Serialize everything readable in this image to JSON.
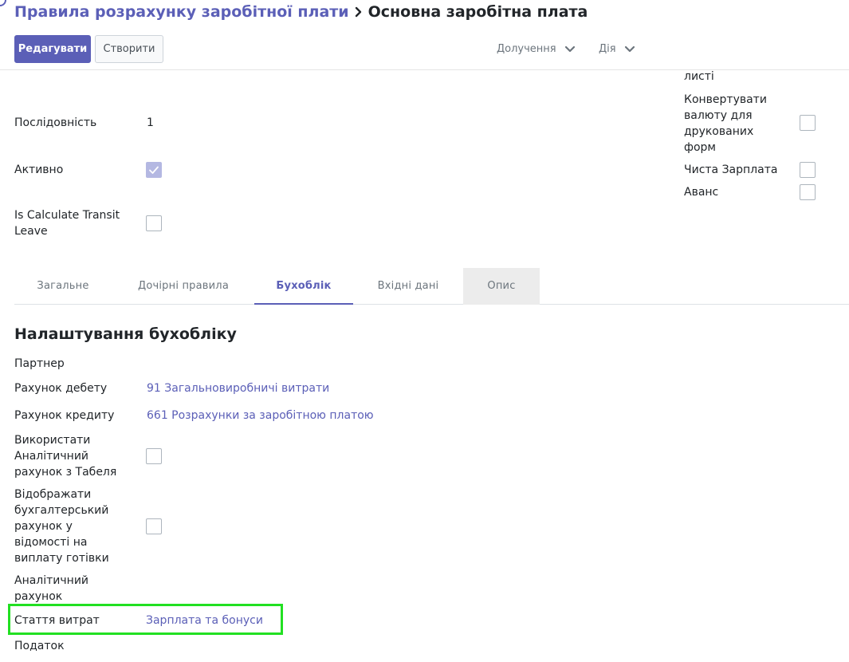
{
  "header": {
    "breadcrumb_parent": "Правила розрахунку заробітної плати",
    "breadcrumb_current": "Основна заробітна плата",
    "edit_label": "Редагувати",
    "create_label": "Створити",
    "attachments_label": "Долучення",
    "action_label": "Дія"
  },
  "form": {
    "right_top_fragment": "листі",
    "sequence_label": "Послідовність",
    "sequence_value": "1",
    "active_label": "Активно",
    "active_checked": true,
    "transit_label": "Is Calculate Transit Leave",
    "transit_checked": false,
    "convert_currency_label": "Конвертувати валюту для друкованих форм",
    "convert_currency_checked": false,
    "net_salary_label": "Чиста Зарплата",
    "net_salary_checked": false,
    "advance_label": "Аванс",
    "advance_checked": false
  },
  "tabs": [
    {
      "label": "Загальне"
    },
    {
      "label": "Дочірні правила"
    },
    {
      "label": "Бухоблік"
    },
    {
      "label": "Вхідні дані"
    },
    {
      "label": "Опис"
    }
  ],
  "active_tab": "Бухоблік",
  "accounting": {
    "title": "Налаштування бухобліку",
    "partner_label": "Партнер",
    "debit_label": "Рахунок дебету",
    "debit_value": "91 Загальновиробничі витрати",
    "credit_label": "Рахунок кредиту",
    "credit_value": "661 Розрахунки за заробітною платою",
    "use_analytic_label": "Використати Аналітичний рахунок з Табеля",
    "use_analytic_checked": false,
    "show_account_label": "Відображати бухгалтерський рахунок у відомості на виплату готівки",
    "show_account_checked": false,
    "analytic_label": "Аналітичний рахунок",
    "expense_item_label": "Стаття витрат",
    "expense_item_value": "Зарплата та бонуси",
    "tax_label": "Податок"
  },
  "colors": {
    "accent": "#5b5fb7",
    "highlight": "#22e022"
  }
}
